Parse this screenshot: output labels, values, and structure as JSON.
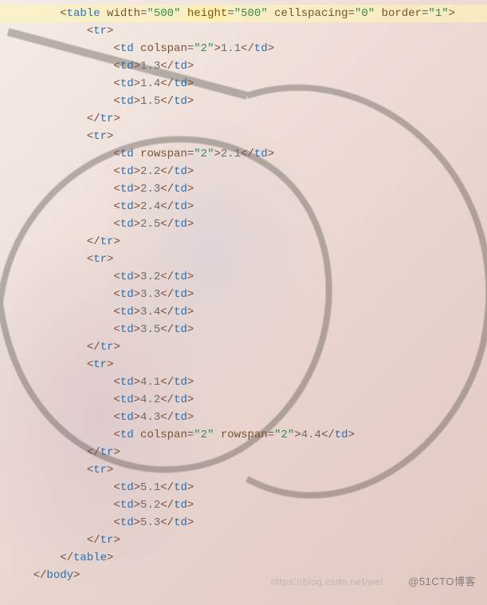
{
  "indent": "    ",
  "baseIndent": 2,
  "watermark1": "https://blog.csdn.net/wei",
  "watermark2": "@51CTO博客",
  "ast": [
    {
      "type": "open",
      "d": 0,
      "tag": "table",
      "hlLine": true,
      "attrs": [
        {
          "name": "width",
          "value": "500"
        },
        {
          "name": "height",
          "value": "500",
          "hl": true
        },
        {
          "name": "cellspacing",
          "value": "0"
        },
        {
          "name": "border",
          "value": "1"
        }
      ]
    },
    {
      "type": "open",
      "d": 1,
      "tag": "tr"
    },
    {
      "type": "leaf",
      "d": 2,
      "tag": "td",
      "attrs": [
        {
          "name": "colspan",
          "value": "2"
        }
      ],
      "text": "1.1"
    },
    {
      "type": "leaf",
      "d": 2,
      "tag": "td",
      "text": "1.3"
    },
    {
      "type": "leaf",
      "d": 2,
      "tag": "td",
      "text": "1.4"
    },
    {
      "type": "leaf",
      "d": 2,
      "tag": "td",
      "text": "1.5"
    },
    {
      "type": "close",
      "d": 1,
      "tag": "tr"
    },
    {
      "type": "open",
      "d": 1,
      "tag": "tr"
    },
    {
      "type": "leaf",
      "d": 2,
      "tag": "td",
      "attrs": [
        {
          "name": "rowspan",
          "value": "2"
        }
      ],
      "text": "2.1"
    },
    {
      "type": "leaf",
      "d": 2,
      "tag": "td",
      "text": "2.2"
    },
    {
      "type": "leaf",
      "d": 2,
      "tag": "td",
      "text": "2.3"
    },
    {
      "type": "leaf",
      "d": 2,
      "tag": "td",
      "text": "2.4"
    },
    {
      "type": "leaf",
      "d": 2,
      "tag": "td",
      "text": "2.5"
    },
    {
      "type": "close",
      "d": 1,
      "tag": "tr"
    },
    {
      "type": "open",
      "d": 1,
      "tag": "tr"
    },
    {
      "type": "leaf",
      "d": 2,
      "tag": "td",
      "text": "3.2"
    },
    {
      "type": "leaf",
      "d": 2,
      "tag": "td",
      "text": "3.3"
    },
    {
      "type": "leaf",
      "d": 2,
      "tag": "td",
      "text": "3.4"
    },
    {
      "type": "leaf",
      "d": 2,
      "tag": "td",
      "text": "3.5"
    },
    {
      "type": "close",
      "d": 1,
      "tag": "tr"
    },
    {
      "type": "open",
      "d": 1,
      "tag": "tr"
    },
    {
      "type": "leaf",
      "d": 2,
      "tag": "td",
      "text": "4.1"
    },
    {
      "type": "leaf",
      "d": 2,
      "tag": "td",
      "text": "4.2"
    },
    {
      "type": "leaf",
      "d": 2,
      "tag": "td",
      "text": "4.3"
    },
    {
      "type": "leaf",
      "d": 2,
      "tag": "td",
      "attrs": [
        {
          "name": "colspan",
          "value": "2"
        },
        {
          "name": "rowspan",
          "value": "2"
        }
      ],
      "text": "4.4"
    },
    {
      "type": "close",
      "d": 1,
      "tag": "tr"
    },
    {
      "type": "open",
      "d": 1,
      "tag": "tr"
    },
    {
      "type": "leaf",
      "d": 2,
      "tag": "td",
      "text": "5.1"
    },
    {
      "type": "leaf",
      "d": 2,
      "tag": "td",
      "text": "5.2"
    },
    {
      "type": "leaf",
      "d": 2,
      "tag": "td",
      "text": "5.3"
    },
    {
      "type": "close",
      "d": 1,
      "tag": "tr"
    },
    {
      "type": "close",
      "d": 0,
      "tag": "table"
    },
    {
      "type": "close-partial",
      "d": -1,
      "tag": "body"
    }
  ]
}
